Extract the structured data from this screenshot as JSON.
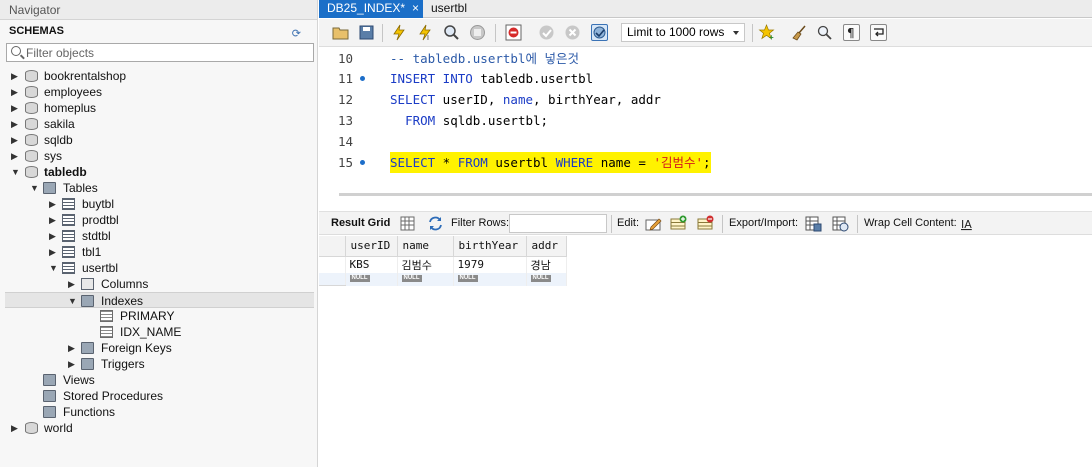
{
  "navigator": {
    "title": "Navigator",
    "schemas_label": "SCHEMAS",
    "filter_placeholder": "Filter objects",
    "tree": [
      {
        "label": "bookrentalshop"
      },
      {
        "label": "employees"
      },
      {
        "label": "homeplus"
      },
      {
        "label": "sakila"
      },
      {
        "label": "sqldb"
      },
      {
        "label": "sys"
      },
      {
        "label": "tabledb"
      },
      {
        "label": "Tables"
      },
      {
        "label": "buytbl"
      },
      {
        "label": "prodtbl"
      },
      {
        "label": "stdtbl"
      },
      {
        "label": "tbl1"
      },
      {
        "label": "usertbl"
      },
      {
        "label": "Columns"
      },
      {
        "label": "Indexes"
      },
      {
        "label": "PRIMARY"
      },
      {
        "label": "IDX_NAME"
      },
      {
        "label": "Foreign Keys"
      },
      {
        "label": "Triggers"
      },
      {
        "label": "Views"
      },
      {
        "label": "Stored Procedures"
      },
      {
        "label": "Functions"
      },
      {
        "label": "world"
      }
    ]
  },
  "tabs": [
    {
      "label": "DB25_INDEX*",
      "close": "×"
    },
    {
      "label": "usertbl"
    }
  ],
  "toolbar": {
    "limit_value": "Limit to 1000 rows"
  },
  "editor": {
    "lines": [
      {
        "num": "10",
        "comment": "-- tabledb.usertbl에 넣은것"
      },
      {
        "num": "11",
        "kw1": "INSERT INTO",
        "rest": " tabledb.usertbl"
      },
      {
        "num": "12",
        "kw1": "SELECT",
        "a": " userID, ",
        "kw2": "name",
        "b": ", birthYear, addr"
      },
      {
        "num": "13",
        "indent": "  ",
        "kw1": "FROM",
        "rest": " sqldb.usertbl;"
      },
      {
        "num": "14"
      },
      {
        "num": "15",
        "kw1": "SELECT",
        "a": " * ",
        "kw2": "FROM",
        "b": " usertbl ",
        "kw3": "WHERE",
        "c": " name = ",
        "str": "'김범수'",
        "d": ";"
      }
    ]
  },
  "result_toolbar": {
    "result_grid": "Result Grid",
    "filter_rows": "Filter Rows:",
    "edit": "Edit:",
    "export_import": "Export/Import:",
    "wrap": "Wrap Cell Content:"
  },
  "grid": {
    "columns": [
      "userID",
      "name",
      "birthYear",
      "addr"
    ],
    "rows": [
      [
        "KBS",
        "김범수",
        "1979",
        "경남"
      ]
    ],
    "null_label": "NULL"
  }
}
